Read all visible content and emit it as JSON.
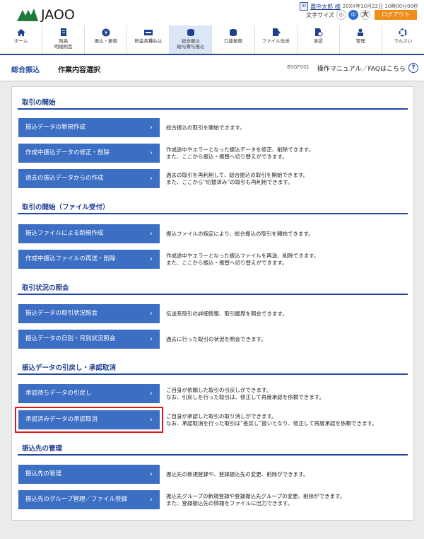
{
  "header": {
    "logo_text": "JAOO",
    "user_name": "農中太郎 様",
    "user_icon": "ID",
    "datetime": "20XX年10月22日 10時00分00秒",
    "text_size_label": "文字サイズ",
    "text_sizes": [
      "小",
      "中",
      "大"
    ],
    "logout": "ログアウト"
  },
  "nav": [
    {
      "label": "ホーム",
      "icon": "home-icon"
    },
    {
      "label": "残高\n明細照会",
      "icon": "document-icon"
    },
    {
      "label": "振込・振替",
      "icon": "yen-icon"
    },
    {
      "label": "税金各種払込",
      "icon": "payment-icon"
    },
    {
      "label": "総合振込\n給与賞与振込",
      "icon": "coins-icon"
    },
    {
      "label": "口座振替",
      "icon": "coins-stack-icon"
    },
    {
      "label": "ファイル伝送",
      "icon": "file-transfer-icon"
    },
    {
      "label": "承認",
      "icon": "approval-icon"
    },
    {
      "label": "管理",
      "icon": "admin-icon"
    },
    {
      "label": "でんさい",
      "icon": "densai-icon"
    }
  ],
  "titlebar": {
    "title": "総合振込",
    "subtitle": "作業内容選択",
    "code": "BSGF001",
    "help": "操作マニュアル／FAQはこちら"
  },
  "sections": [
    {
      "title": "取引の開始",
      "items": [
        {
          "label": "振込データの新規作成",
          "desc": "総合振込の取引を開始できます。"
        },
        {
          "label": "作成中振込データの修正・削除",
          "desc": "作成途中やエラーとなった振込データを修正、削除できます。\nまた、ここから振込・振替へ切り替えができます。"
        },
        {
          "label": "過去の振込データからの作成",
          "desc": "過去の取引を再利用して、総合振込の取引を開始できます。\nまた、ここから“切替済み”の取引も再利用できます。"
        }
      ]
    },
    {
      "title": "取引の開始（ファイル受付）",
      "items": [
        {
          "label": "振込ファイルによる新規作成",
          "desc": "振込ファイルの指定により、総合振込の取引を開始できます。"
        },
        {
          "label": "作成中振込ファイルの再送・削除",
          "desc": "作成途中やエラーとなった振込ファイルを再送、削除できます。\nまた、ここから振込・振替へ切り替えができます。"
        }
      ]
    },
    {
      "title": "取引状況の照会",
      "items": [
        {
          "label": "振込データの取引状況照会",
          "desc": "伝送系取引の詳細情報、取引履歴を照会できます。"
        },
        {
          "label": "振込データの日別・月別状況照会",
          "desc": "過去に行った取引の状況を照会できます。"
        }
      ]
    },
    {
      "title": "振込データの引戻し・承認取消",
      "items": [
        {
          "label": "承認待ちデータの引戻し",
          "desc": "ご自身が依頼した取引の引戻しができます。\nなお、引戻しを行った取引は、修正して再度承認を依頼できます。"
        },
        {
          "label": "承認済みデータの承認取消",
          "desc": "ご自身が承認した取引の取り消しができます。\nなお、承認取消を行った取引は“差戻し”扱いとなり、修正して再度承認を依頼できます。"
        }
      ]
    },
    {
      "title": "振込先の管理",
      "items": [
        {
          "label": "振込先の管理",
          "desc": "振込先の新規登録や、登録振込先の変更、削除ができます。"
        },
        {
          "label": "振込先のグループ管理／ファイル登録",
          "desc": "振込先グループの新規登録や登録振込先グループの変更、削除ができます。\nまた、登録振込先の情報をファイルに出力できます。"
        }
      ]
    }
  ],
  "chevron": "›"
}
